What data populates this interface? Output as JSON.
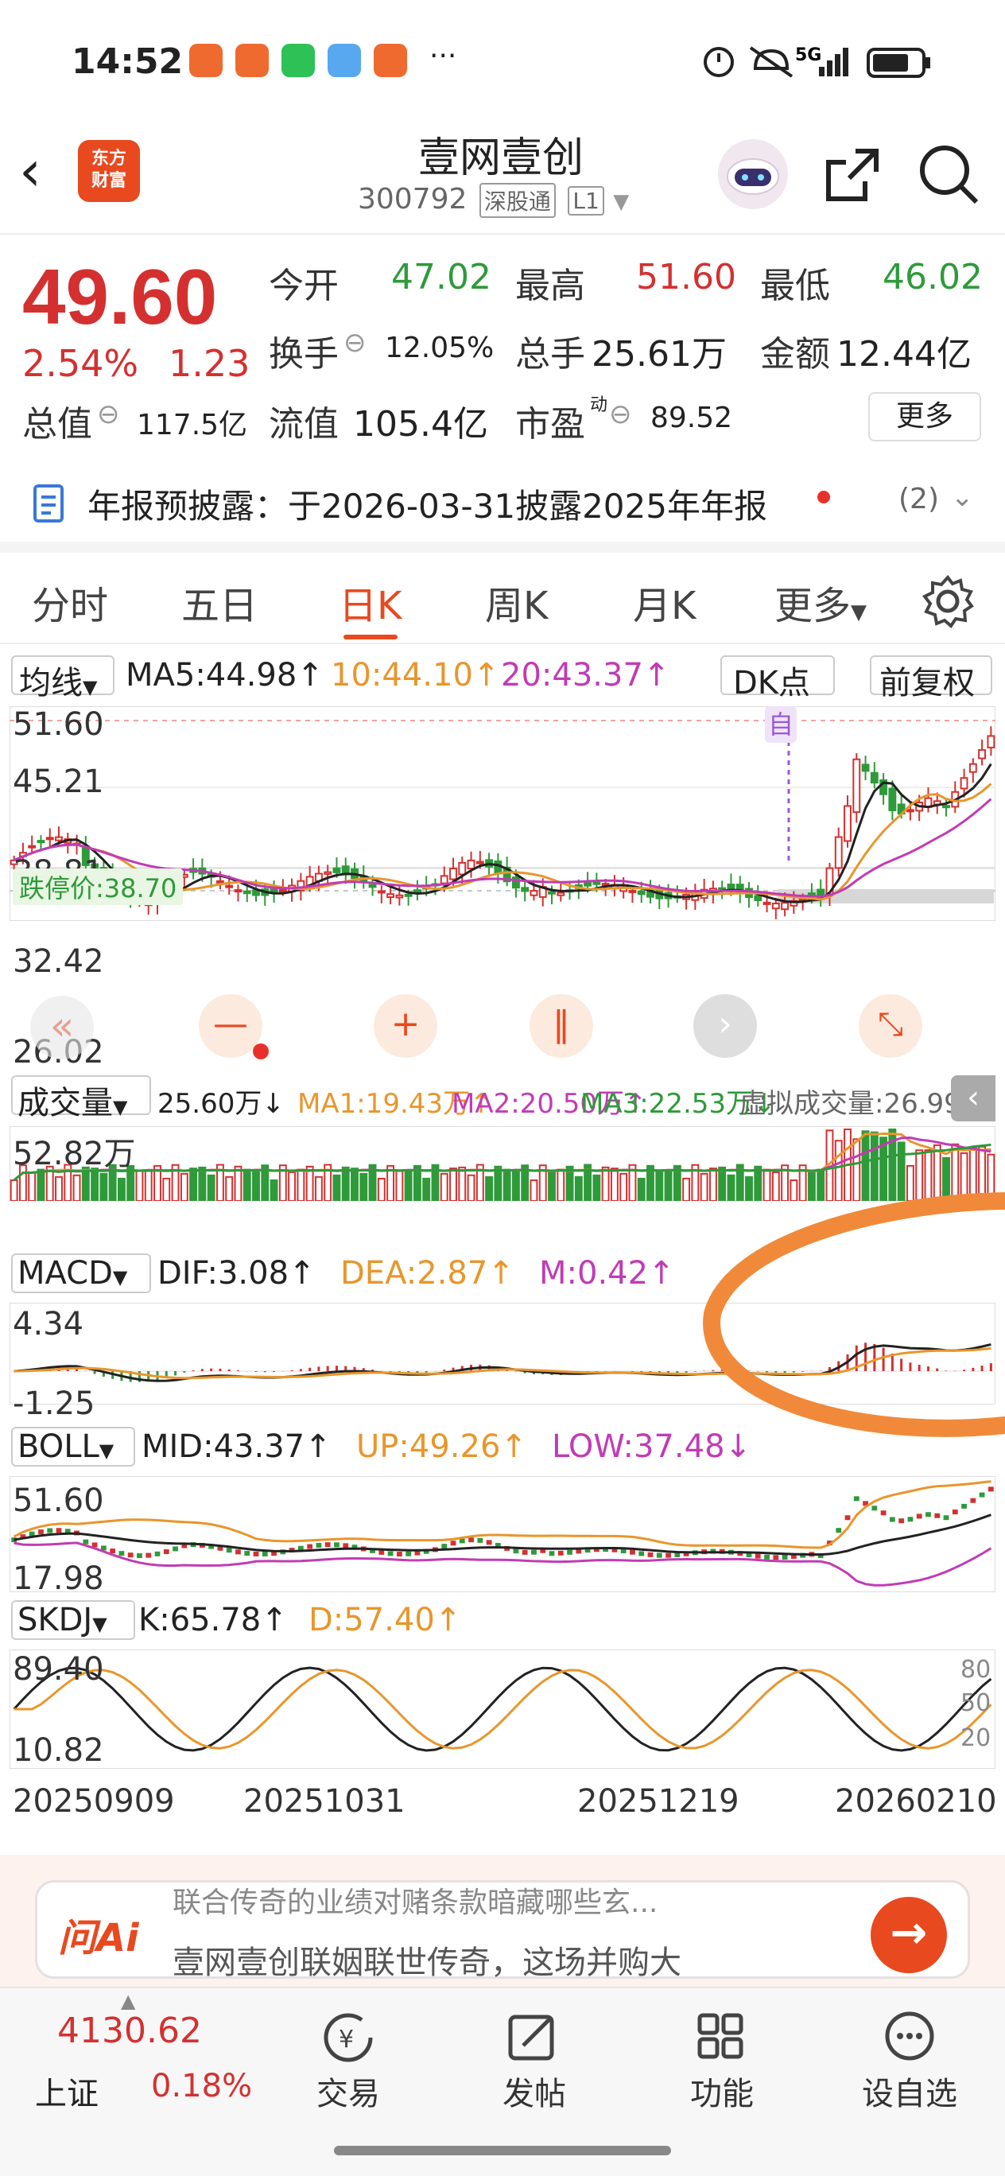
{
  "status_bar": {
    "time": "14:52",
    "overflow": "···",
    "network": "5G"
  },
  "header": {
    "logo_text_1": "东方",
    "logo_text_2": "财富",
    "stock_name": "壹网壹创",
    "stock_code": "300792",
    "tag_connect": "深股通",
    "tag_level": "L1"
  },
  "quote": {
    "price": "49.60",
    "change_pct": "2.54%",
    "change": "1.23",
    "open_label": "今开",
    "open": "47.02",
    "high_label": "最高",
    "high": "51.60",
    "low_label": "最低",
    "low": "46.02",
    "turnover_label": "换手",
    "turnover": "12.05%",
    "volume_label": "总手",
    "volume": "25.61万",
    "amount_label": "金额",
    "amount": "12.44亿",
    "mktcap_label": "总值",
    "mktcap": "117.5亿",
    "float_label": "流值",
    "float_cap": "105.4亿",
    "pe_label": "市盈",
    "pe_sup": "动",
    "pe": "89.52",
    "more": "更多"
  },
  "notice": {
    "text": "年报预披露：于2026-03-31披露2025年年报",
    "count": "(2)"
  },
  "tabs": [
    "分时",
    "五日",
    "日K",
    "周K",
    "月K",
    "更多"
  ],
  "active_tab": 2,
  "kline": {
    "ma_selector": "均线",
    "ma5": "MA5:44.98↑",
    "ma10": "10:44.10↑",
    "ma20": "20:43.37↑",
    "dk_button": "DK点",
    "adjust_button": "前复权",
    "y_top": "51.60",
    "y_2": "45.21",
    "y_3": "38.81",
    "y_4": "32.42",
    "y_bottom": "26.02",
    "limit_down_label": "跌停价:38.70",
    "self_tag": "自"
  },
  "volume": {
    "selector": "成交量",
    "vol": "25.60万↓",
    "ma1": "MA1:19.43万↑",
    "ma2": "MA2:20.50万↑",
    "ma3": "MA3:22.53万↓",
    "virtual": "虚拟成交量:26.99万",
    "y_max": "52.82万"
  },
  "macd": {
    "selector": "MACD",
    "dif": "DIF:3.08↑",
    "dea": "DEA:2.87↑",
    "m": "M:0.42↑",
    "y_top": "4.34",
    "y_bottom": "-1.25"
  },
  "boll": {
    "selector": "BOLL",
    "mid": "MID:43.37↑",
    "up": "UP:49.26↑",
    "low": "LOW:37.48↓",
    "y_top": "51.60",
    "y_bottom": "17.98"
  },
  "skdj": {
    "selector": "SKDJ",
    "k": "K:65.78↑",
    "d": "D:57.40↑",
    "y_top": "89.40",
    "y_bottom": "10.82",
    "r80": "80",
    "r50": "50",
    "r20": "20"
  },
  "x_dates": [
    "20250909",
    "20251031",
    "20251219",
    "20260210"
  ],
  "ai": {
    "logo": "问Ai",
    "line1": "联合传奇的业绩对赌条款暗藏哪些玄...",
    "line2": "壹网壹创联姻联世传奇，这场并购大"
  },
  "bottom_nav": {
    "index_value": "4130.62",
    "index_name": "上证",
    "index_pct": "0.18%",
    "items": [
      "交易",
      "发帖",
      "功能",
      "设自选"
    ]
  },
  "colors": {
    "up": "#d43030",
    "down": "#2e9a3a",
    "accent": "#e8491f",
    "ma10": "#e8962c",
    "ma20": "#c23bb5"
  }
}
